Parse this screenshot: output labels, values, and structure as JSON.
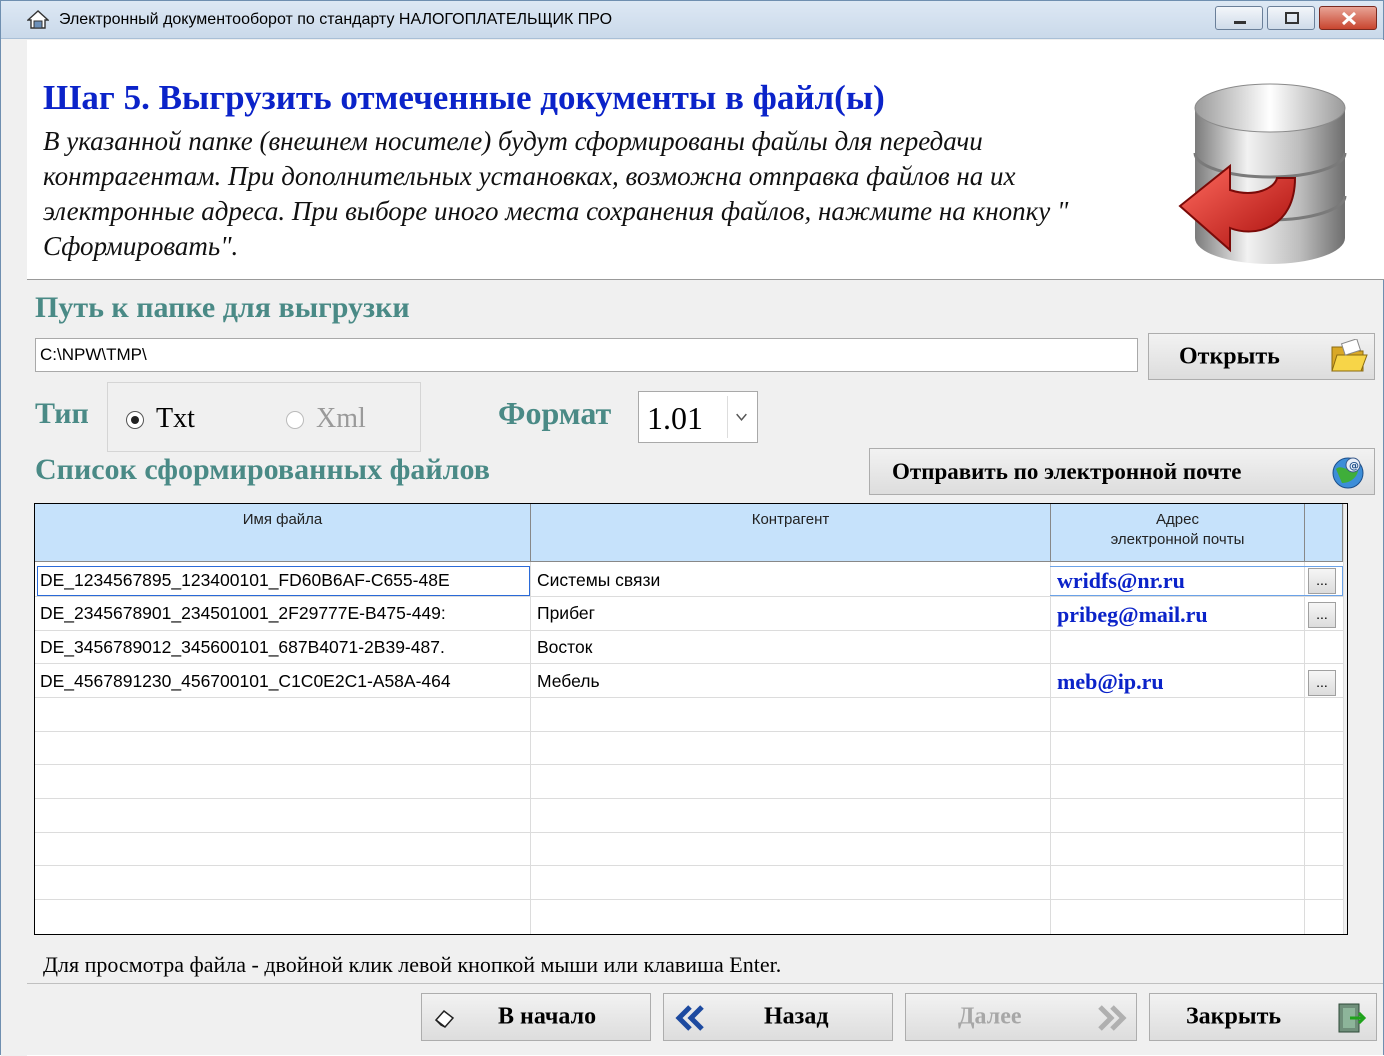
{
  "window": {
    "title": "Электронный документооборот по стандарту НАЛОГОПЛАТЕЛЬЩИК ПРО"
  },
  "header": {
    "title": "Шаг 5. Выгрузить отмеченные документы в файл(ы)",
    "description": "В указанной папке (внешнем носителе) будут сформированы файлы для передачи контрагентам.  При дополнительных установках, возможна отправка файлов на их электронные адреса. При выборе иного места сохранения файлов, нажмите на кнопку \"  Сформировать\"."
  },
  "export_path": {
    "label": "Путь к папке для выгрузки",
    "value": "C:\\NPW\\TMP\\",
    "open_label": "Открыть"
  },
  "type": {
    "label": "Тип",
    "options": [
      {
        "label": "Txt",
        "checked": true,
        "enabled": true
      },
      {
        "label": "Xml",
        "checked": false,
        "enabled": false
      }
    ]
  },
  "format": {
    "label": "Формат",
    "selected": "1.01"
  },
  "files": {
    "label": "Список сформированных файлов",
    "send_email_label": "Отправить по электронной почте",
    "columns": [
      "Имя файла",
      "Контрагент",
      "Адрес",
      "электронной почты"
    ],
    "rows": [
      {
        "file": "DE_1234567895_123400101_FD60B6AF-C655-48E",
        "contractor": "Системы связи",
        "email": "wridfs@nr.ru",
        "has_button": true
      },
      {
        "file": "DE_2345678901_234501001_2F29777E-B475-449:",
        "contractor": "Прибег",
        "email": "pribeg@mail.ru",
        "has_button": true
      },
      {
        "file": "DE_3456789012_345600101_687B4071-2B39-487.",
        "contractor": "Восток",
        "email": "",
        "has_button": false
      },
      {
        "file": "DE_4567891230_456700101_C1C0E2C1-A58A-464",
        "contractor": "Мебель",
        "email": "meb@ip.ru",
        "has_button": true
      }
    ],
    "ellipsis": "..."
  },
  "hint": "Для просмотра файла - двойной клик левой кнопкой мыши или клавиша Enter.",
  "footer": {
    "start_label": "В начало",
    "back_label": "Назад",
    "next_label": "Далее",
    "close_label": "Закрыть"
  },
  "colors": {
    "title_blue": "#0b23c9",
    "section_teal": "#4a8a86",
    "grid_header": "#c6e2fb"
  }
}
